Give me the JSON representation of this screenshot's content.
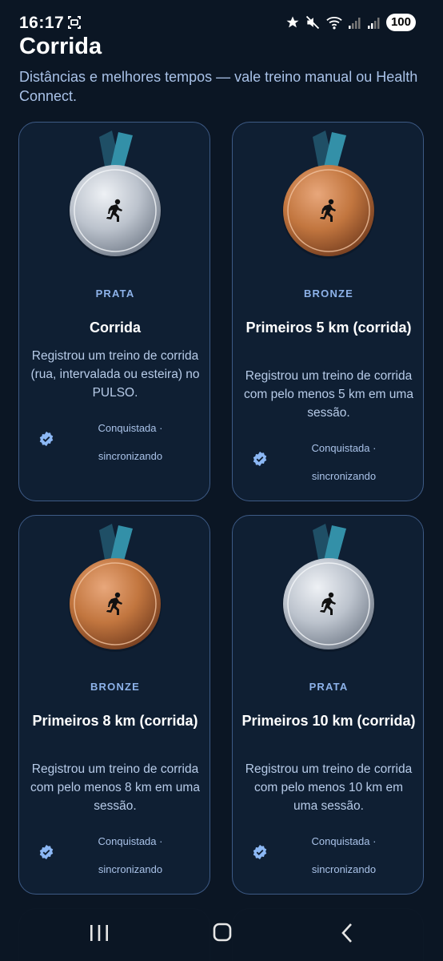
{
  "status_bar": {
    "time": "16:17",
    "battery": "100",
    "icons": [
      "screenshot-icon",
      "star-icon",
      "mute-icon",
      "wifi-icon",
      "signal-icon",
      "signal-icon"
    ]
  },
  "header": {
    "title": "Corrida",
    "subtitle": "Distâncias e melhores tempos — vale treino manual ou Health Connect."
  },
  "colors": {
    "background": "#0b1624",
    "card_border": "#3d5a85",
    "tier_label": "#8db2e9",
    "silver": "#c4cad4",
    "bronze": "#c0784a",
    "ribbon": "#2e7f96",
    "verified": "#8cb8f5"
  },
  "cards": [
    {
      "tier": "PRATA",
      "title": "Corrida",
      "description": "Registrou um treino de corrida (rua, intervalada ou esteira) no PULSO.",
      "status_line1": "Conquistada ·",
      "status_line2": "sincronizando",
      "medal": "silver",
      "icon": "runner-icon"
    },
    {
      "tier": "BRONZE",
      "title": "Primeiros 5 km (corrida)",
      "description": "Registrou um treino de corrida com pelo menos 5 km em uma sessão.",
      "status_line1": "Conquistada ·",
      "status_line2": "sincronizando",
      "medal": "bronze",
      "icon": "runner-icon"
    },
    {
      "tier": "BRONZE",
      "title": "Primeiros 8 km (corrida)",
      "description": "Registrou um treino de corrida com pelo menos 8 km em uma sessão.",
      "status_line1": "Conquistada ·",
      "status_line2": "sincronizando",
      "medal": "bronze",
      "icon": "runner-icon"
    },
    {
      "tier": "PRATA",
      "title": "Primeiros 10 km (corrida)",
      "description": "Registrou um treino de corrida com pelo menos 10 km em uma sessão.",
      "status_line1": "Conquistada ·",
      "status_line2": "sincronizando",
      "medal": "silver",
      "icon": "runner-icon"
    }
  ],
  "nav_bar": {
    "buttons": [
      "recent-apps-icon",
      "home-icon",
      "back-icon"
    ]
  }
}
